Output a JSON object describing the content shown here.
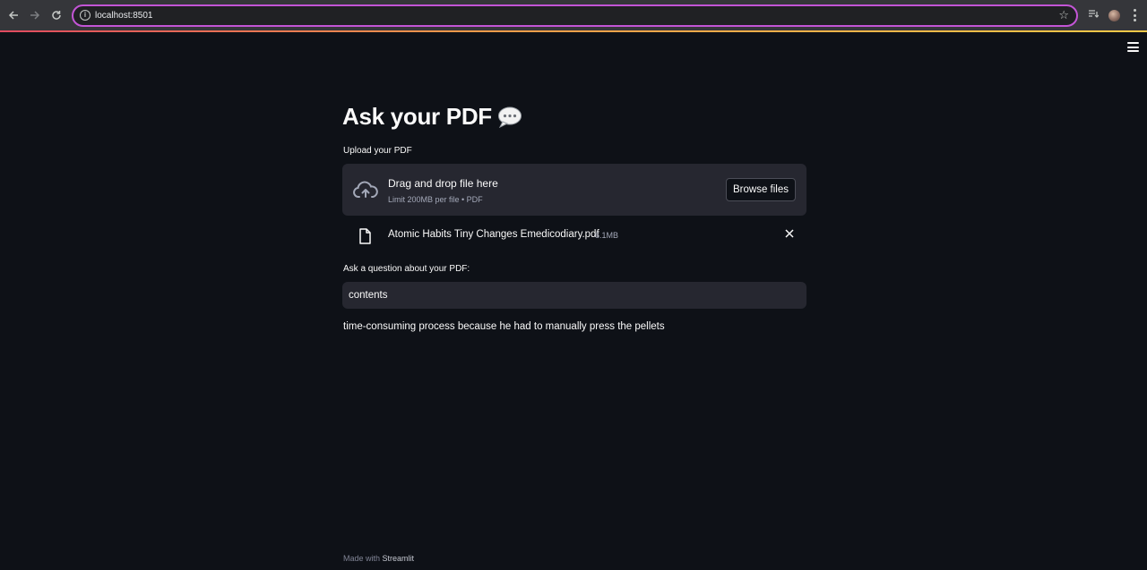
{
  "browser": {
    "url": "localhost:8501"
  },
  "app": {
    "title": "Ask your PDF",
    "upload_label": "Upload your PDF",
    "dropzone": {
      "main_text": "Drag and drop file here",
      "sub_text": "Limit 200MB per file • PDF",
      "browse_label": "Browse files"
    },
    "uploaded_file": {
      "name": "Atomic Habits Tiny Changes Emedicodiary.pdf",
      "size": "6.1MB"
    },
    "question_label": "Ask a question about your PDF:",
    "question_value": "contents",
    "answer": "time-consuming process because he had to manually press the pellets",
    "footer": {
      "prefix": "Made with",
      "brand": "Streamlit"
    }
  },
  "colors": {
    "background": "#0e1117",
    "widget": "#262730",
    "text": "#fafafa",
    "muted": "#a3a8b8",
    "omnibox_focus": "#c355d6"
  },
  "icons": [
    "back-icon",
    "forward-icon",
    "reload-icon",
    "info-icon",
    "star-icon",
    "reading-list-icon",
    "profile-avatar",
    "menu-dots-icon",
    "hamburger-icon",
    "speech-balloon-icon",
    "cloud-upload-icon",
    "file-icon",
    "close-icon"
  ]
}
